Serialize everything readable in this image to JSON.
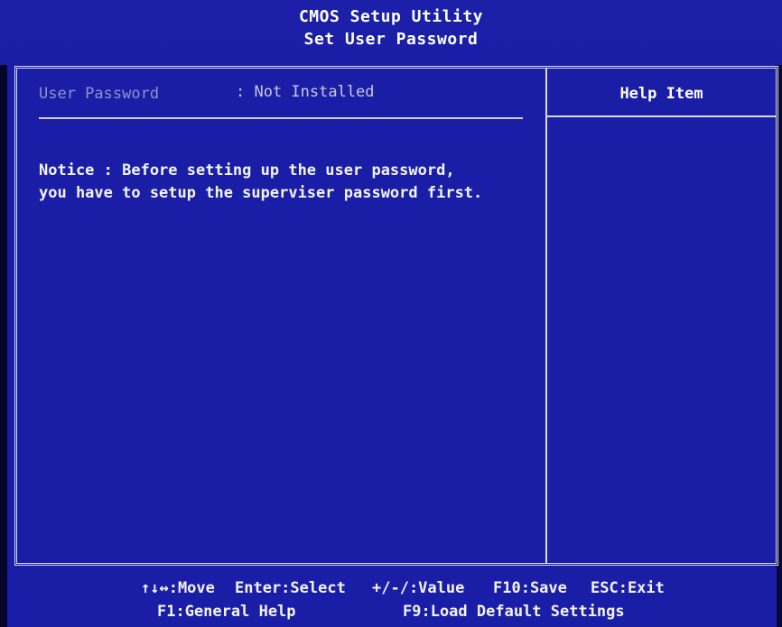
{
  "header": {
    "title": "CMOS Setup Utility",
    "subtitle": "Set User Password"
  },
  "main": {
    "field": {
      "label": "User Password",
      "value": ": Not Installed"
    },
    "notice": [
      "Notice : Before setting up the user password,",
      "you have to setup the superviser password first."
    ]
  },
  "help": {
    "title": "Help Item"
  },
  "footer": {
    "row1": [
      {
        "label": "↑↓↔:Move"
      },
      {
        "label": "Enter:Select"
      },
      {
        "label": "+/-/:Value"
      },
      {
        "label": "F10:Save"
      },
      {
        "label": "ESC:Exit"
      }
    ],
    "row2": [
      {
        "label": "F1:General Help"
      },
      {
        "label": "F9:Load Default Settings"
      }
    ]
  },
  "colors": {
    "background": "#1a1ea6",
    "frame": "#d8d8e8",
    "text": "#f4f4f4",
    "disabled_text": "#8f93c8"
  }
}
